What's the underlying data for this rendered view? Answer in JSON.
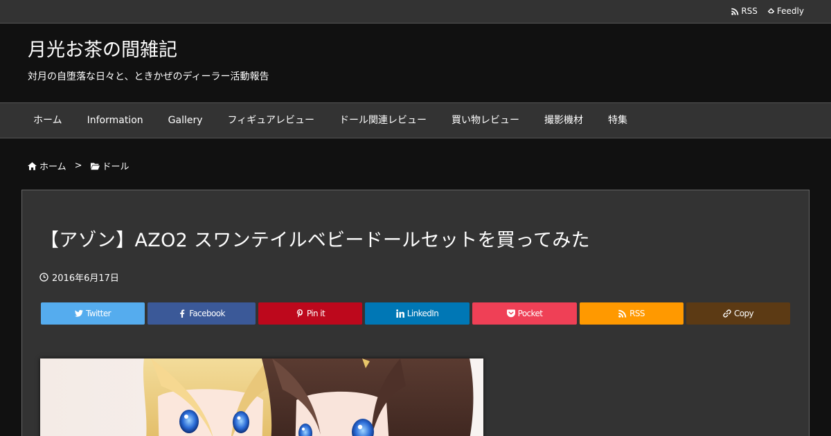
{
  "topbar": {
    "rss_label": "RSS",
    "feedly_label": "Feedly"
  },
  "site": {
    "title": "月光お茶の間雑記",
    "description": "対月の自堕落な日々と、ときかぜのディーラー活動報告"
  },
  "nav": {
    "items": [
      {
        "label": "ホーム"
      },
      {
        "label": "Information"
      },
      {
        "label": "Gallery"
      },
      {
        "label": "フィギュアレビュー"
      },
      {
        "label": "ドール関連レビュー"
      },
      {
        "label": "買い物レビュー"
      },
      {
        "label": "撮影機材"
      },
      {
        "label": "特集"
      }
    ]
  },
  "breadcrumb": {
    "home": "ホーム",
    "separator": ">",
    "category": "ドール"
  },
  "article": {
    "title": "【アゾン】AZO2 スワンテイルベビードールセットを買ってみた",
    "date": "2016年6月17日"
  },
  "share": {
    "buttons": [
      {
        "label": "Twitter",
        "color": "#55acee",
        "icon": "twitter-icon"
      },
      {
        "label": "Facebook",
        "color": "#3b5998",
        "icon": "facebook-icon"
      },
      {
        "label": "Pin it",
        "color": "#bd081c",
        "icon": "pinterest-icon"
      },
      {
        "label": "LinkedIn",
        "color": "#0077b5",
        "icon": "linkedin-icon"
      },
      {
        "label": "Pocket",
        "color": "#ef4056",
        "icon": "pocket-icon"
      },
      {
        "label": "RSS",
        "color": "#ff9900",
        "icon": "rss-icon"
      },
      {
        "label": "Copy",
        "color": "#5c3a14",
        "icon": "link-icon"
      }
    ]
  },
  "colors": {
    "background": "#111111",
    "bars": "#333333",
    "card": "#333333"
  }
}
